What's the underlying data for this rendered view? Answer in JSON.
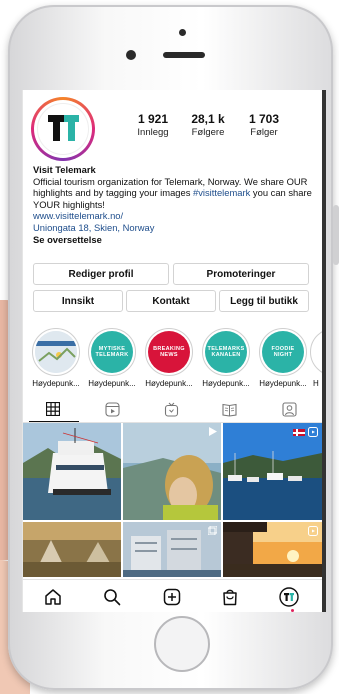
{
  "profile": {
    "stats": [
      {
        "value": "1 921",
        "label": "Innlegg"
      },
      {
        "value": "28,1 k",
        "label": "Følgere"
      },
      {
        "value": "1 703",
        "label": "Følger"
      }
    ],
    "name": "Visit Telemark",
    "bio_line1": "Official tourism organization for Telemark, Norway. We share OUR highlights and by tagging your images ",
    "hashtag": "#visittelemark",
    "bio_line2": " you can share YOUR highlights!",
    "website": "www.visittelemark.no/",
    "address": "Uniongata 18, Skien, Norway",
    "translate": "Se oversettelse"
  },
  "actions": {
    "edit_profile": "Rediger profil",
    "promotions": "Promoteringer",
    "insights": "Innsikt",
    "contact": "Kontakt",
    "add_shop": "Legg til butikk"
  },
  "highlights": [
    {
      "label": "Høydepunk...",
      "cover_text": "",
      "color": "#e8e8e8"
    },
    {
      "label": "Høydepunk...",
      "cover_text": "MYTISKE TELEMARK",
      "color": "#2bb3a7"
    },
    {
      "label": "Høydepunk...",
      "cover_text": "BREAKING NEWS",
      "color": "#d8143a"
    },
    {
      "label": "Høydepunk...",
      "cover_text": "TELEMARKS KANALEN",
      "color": "#2bb3a7"
    },
    {
      "label": "Høydepunk...",
      "cover_text": "FOODIE NIGHT",
      "color": "#2bb3a7"
    },
    {
      "label": "H",
      "cover_text": "",
      "color": "#ffffff"
    }
  ],
  "tabs": [
    "grid-tab",
    "reels-tab",
    "igtv-tab",
    "guides-tab",
    "tagged-tab"
  ],
  "colors": {
    "link": "#1f4e8c",
    "brand_teal": "#2bb3a7",
    "notification": "#e0245e"
  }
}
